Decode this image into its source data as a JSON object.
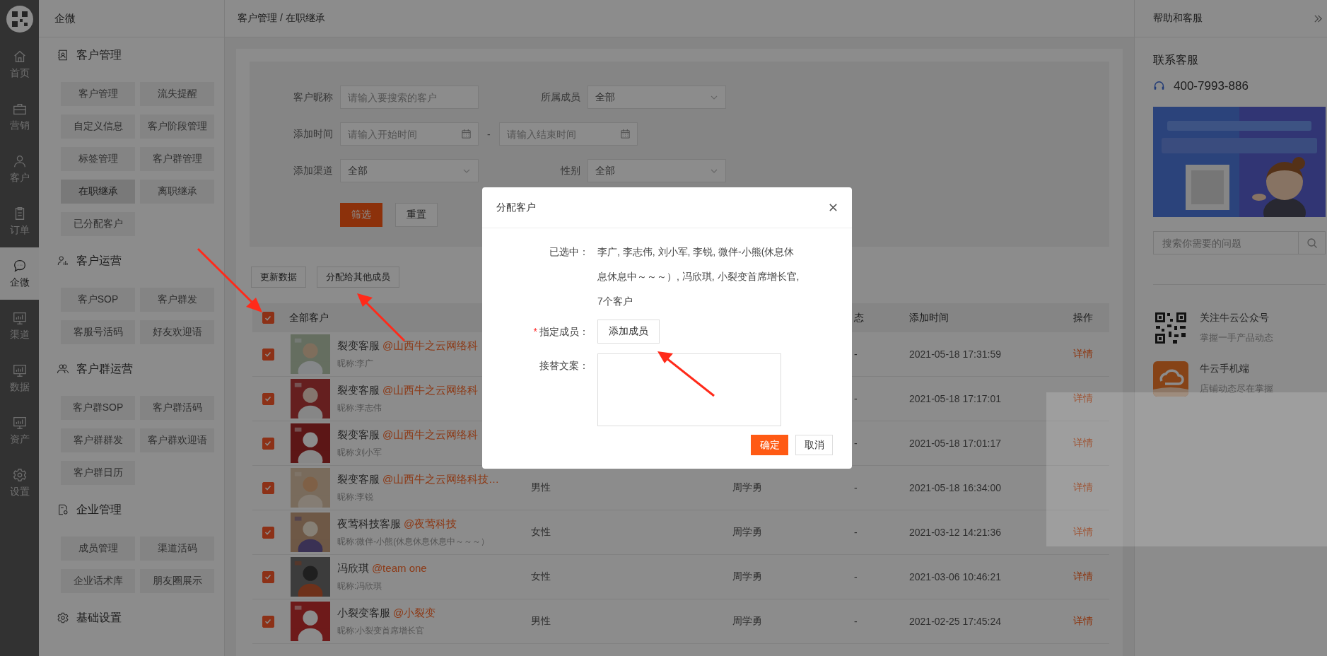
{
  "nav": {
    "items": [
      {
        "label": "首页",
        "selected": false
      },
      {
        "label": "营销",
        "selected": false
      },
      {
        "label": "客户",
        "selected": false
      },
      {
        "label": "订单",
        "selected": false
      },
      {
        "label": "企微",
        "selected": true
      },
      {
        "label": "渠道",
        "selected": false
      },
      {
        "label": "数据",
        "selected": false
      },
      {
        "label": "资产",
        "selected": false
      },
      {
        "label": "设置",
        "selected": false
      }
    ]
  },
  "sidebar": {
    "title": "企微",
    "sections": [
      {
        "title": "客户管理",
        "items": [
          {
            "label": "客户管理",
            "selected": false
          },
          {
            "label": "流失提醒",
            "selected": false
          },
          {
            "label": "自定义信息",
            "selected": false
          },
          {
            "label": "客户阶段管理",
            "selected": false
          },
          {
            "label": "标签管理",
            "selected": false
          },
          {
            "label": "客户群管理",
            "selected": false
          },
          {
            "label": "在职继承",
            "selected": true
          },
          {
            "label": "离职继承",
            "selected": false
          },
          {
            "label": "已分配客户",
            "selected": false
          }
        ]
      },
      {
        "title": "客户运营",
        "items": [
          {
            "label": "客户SOP",
            "selected": false
          },
          {
            "label": "客户群发",
            "selected": false
          },
          {
            "label": "客服号活码",
            "selected": false
          },
          {
            "label": "好友欢迎语",
            "selected": false
          }
        ]
      },
      {
        "title": "客户群运营",
        "items": [
          {
            "label": "客户群SOP",
            "selected": false
          },
          {
            "label": "客户群活码",
            "selected": false
          },
          {
            "label": "客户群群发",
            "selected": false
          },
          {
            "label": "客户群欢迎语",
            "selected": false
          },
          {
            "label": "客户群日历",
            "selected": false
          }
        ]
      },
      {
        "title": "企业管理",
        "items": [
          {
            "label": "成员管理",
            "selected": false
          },
          {
            "label": "渠道活码",
            "selected": false
          },
          {
            "label": "企业话术库",
            "selected": false
          },
          {
            "label": "朋友圈展示",
            "selected": false
          }
        ]
      },
      {
        "title": "基础设置"
      }
    ]
  },
  "breadcrumb": "客户管理 / 在职继承",
  "filter": {
    "fields": [
      {
        "kind": "text",
        "label": "客户昵称",
        "placeholder": "请输入要搜索的客户"
      },
      {
        "kind": "select",
        "label": "所属成员",
        "value": "全部"
      },
      {
        "kind": "daterange",
        "label": "添加时间",
        "start_placeholder": "请输入开始时间",
        "separator": "-",
        "end_placeholder": "请输入结束时间"
      },
      {
        "kind": "select",
        "label": "添加渠道",
        "value": "全部"
      },
      {
        "kind": "select",
        "label": "性别",
        "value": "全部"
      }
    ],
    "buttons": [
      {
        "label": "筛选",
        "kind": "primary"
      },
      {
        "label": "重置",
        "kind": "default"
      }
    ]
  },
  "actions": [
    "更新数据",
    "分配给其他成员"
  ],
  "table": {
    "all_checked": true,
    "columns": {
      "customer": "全部客户",
      "status": "态",
      "time": "添加时间",
      "action": "操作"
    },
    "rows": [
      {
        "checked": true,
        "name": "裂变客服",
        "company": "@山西牛之云网络科",
        "nickname": "昵称:李广",
        "status": "-",
        "time": "2021-05-18 17:31:59",
        "action": "详情"
      },
      {
        "checked": true,
        "name": "裂变客服",
        "company": "@山西牛之云网络科",
        "nickname": "昵称:李志伟",
        "status": "-",
        "time": "2021-05-18 17:17:01",
        "action": "详情"
      },
      {
        "checked": true,
        "name": "裂变客服",
        "company": "@山西牛之云网络科",
        "nickname": "昵称:刘小军",
        "status": "-",
        "time": "2021-05-18 17:01:17",
        "action": "详情"
      },
      {
        "checked": true,
        "name": "裂变客服",
        "company": "@山西牛之云网络科技…",
        "nickname": "昵称:李锐",
        "gender": "男性",
        "member": "周学勇",
        "status": "-",
        "time": "2021-05-18 16:34:00",
        "action": "详情"
      },
      {
        "checked": true,
        "name": "夜莺科技客服",
        "company": "@夜莺科技",
        "nickname": "昵称:微伴-小熊(休息休息休息中～～～）",
        "gender": "女性",
        "member": "周学勇",
        "status": "-",
        "time": "2021-03-12 14:21:36",
        "action": "详情"
      },
      {
        "checked": true,
        "name": "冯欣琪",
        "company": "@team one",
        "nickname": "昵称:冯欣琪",
        "gender": "女性",
        "member": "周学勇",
        "status": "-",
        "time": "2021-03-06 10:46:21",
        "action": "详情"
      },
      {
        "checked": true,
        "name": "小裂变客服",
        "company": "@小裂变",
        "nickname": "昵称:小裂变首席增长官",
        "gender": "男性",
        "member": "周学勇",
        "status": "-",
        "time": "2021-02-25 17:45:24",
        "action": "详情"
      }
    ]
  },
  "help": {
    "title": "帮助和客服",
    "contact_title": "联系客服",
    "phone": "400-7993-886",
    "search_placeholder": "搜索你需要的问题",
    "links": [
      {
        "title": "关注牛云公众号",
        "subtitle": "掌握一手产品动态"
      },
      {
        "title": "牛云手机端",
        "subtitle": "店铺动态尽在掌握"
      }
    ]
  },
  "modal": {
    "title": "分配客户",
    "fields": [
      {
        "kind": "text",
        "label": "已选中：",
        "value": "李广, 李志伟, 刘小军, 李锐, 微伴-小熊(休息休息休息中～～～）, 冯欣琪, 小裂变首席增长官, 7个客户"
      },
      {
        "kind": "button",
        "label": "指定成员：",
        "required_mark": "*",
        "button": "添加成员"
      },
      {
        "kind": "textarea",
        "label": "接替文案："
      }
    ],
    "buttons": [
      {
        "label": "确定",
        "kind": "primary"
      },
      {
        "label": "取消",
        "kind": "default"
      }
    ]
  }
}
